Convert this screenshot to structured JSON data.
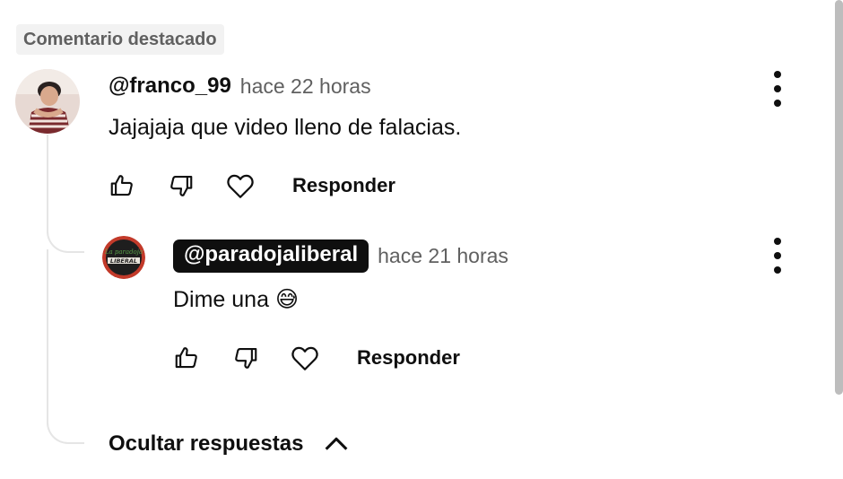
{
  "section_label": "Comentario destacado",
  "comment": {
    "author": "@franco_99",
    "time": "hace 22 horas",
    "text": "Jajajaja que video lleno de falacias.",
    "reply_label": "Responder"
  },
  "reply": {
    "author": "@paradojaliberal",
    "time": "hace 21 horas",
    "text": "Dime una 😅",
    "reply_label": "Responder",
    "avatar_text_top": "La paradoja",
    "avatar_text_bottom": "LIBERAL"
  },
  "hide_replies_label": "Ocultar respuestas",
  "colors": {
    "text_primary": "#0f0f0f",
    "text_secondary": "#606060",
    "thread_line": "#e5e5e5",
    "creator_pill": "#0f0f0f"
  },
  "icons": [
    "like-icon",
    "dislike-icon",
    "heart-icon",
    "more-vert-icon",
    "chevron-up-icon"
  ]
}
